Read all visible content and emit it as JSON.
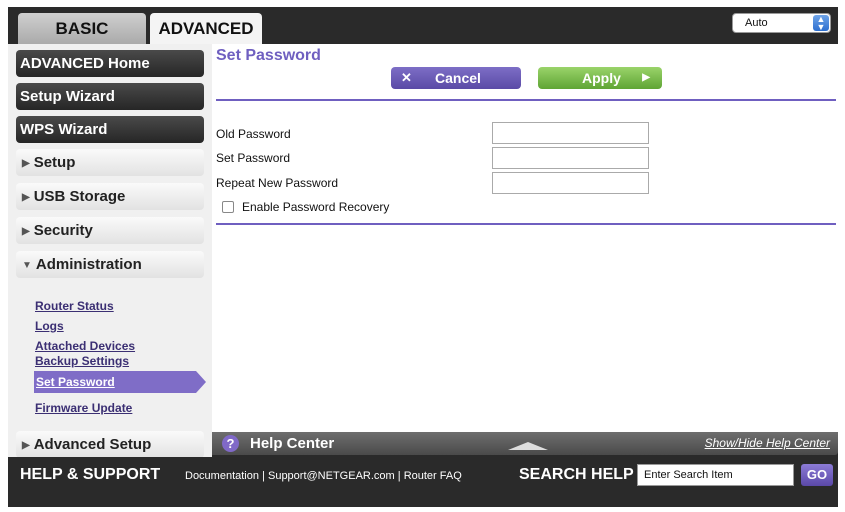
{
  "tabs": {
    "basic": "BASIC",
    "advanced": "ADVANCED"
  },
  "language_select": {
    "value": "Auto"
  },
  "sidebar": {
    "advanced_home": "ADVANCED Home",
    "setup_wizard": "Setup Wizard",
    "wps_wizard": "WPS Wizard",
    "setup": "Setup",
    "usb_storage": "USB Storage",
    "security": "Security",
    "administration": "Administration",
    "sub_items": [
      "Router Status",
      "Logs",
      "Attached Devices",
      "Backup Settings",
      "Set Password",
      "Firmware Update"
    ],
    "advanced_setup": "Advanced Setup"
  },
  "main": {
    "title": "Set Password",
    "cancel_label": "Cancel",
    "apply_label": "Apply",
    "fields": [
      "Old Password",
      "Set Password",
      "Repeat New Password"
    ],
    "recovery_label": "Enable Password Recovery"
  },
  "help": {
    "title": "Help Center",
    "toggle": "Show/Hide Help Center"
  },
  "footer": {
    "title": "HELP & SUPPORT",
    "links": [
      "Documentation",
      "Support@NETGEAR.com",
      "Router FAQ"
    ],
    "search_title": "SEARCH HELP",
    "search_placeholder": "Enter Search Item",
    "go_label": "GO"
  },
  "colors": {
    "accent": "#6f5fc0",
    "apply": "#6fb33f",
    "dark": "#2a2a2a"
  }
}
